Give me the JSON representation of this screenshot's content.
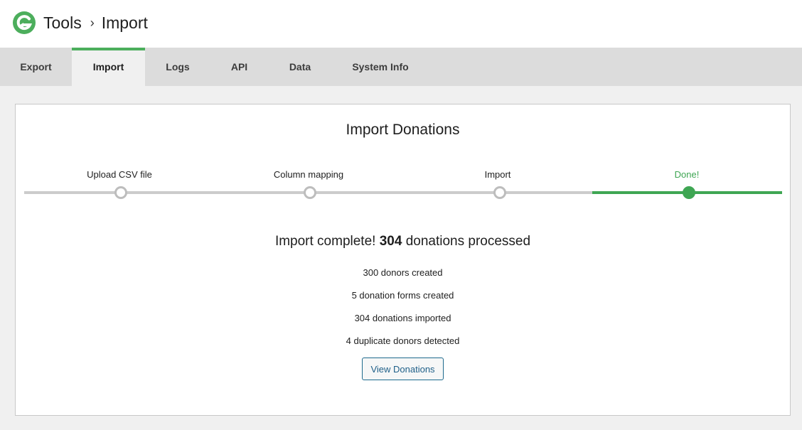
{
  "header": {
    "breadcrumb": [
      "Tools",
      "Import"
    ],
    "separator": "›",
    "brand_color": "#3fa653"
  },
  "tabs": [
    {
      "label": "Export",
      "active": false
    },
    {
      "label": "Import",
      "active": true
    },
    {
      "label": "Logs",
      "active": false
    },
    {
      "label": "API",
      "active": false
    },
    {
      "label": "Data",
      "active": false
    },
    {
      "label": "System Info",
      "active": false
    }
  ],
  "panel": {
    "title": "Import Donations",
    "steps": [
      {
        "label": "Upload CSV file",
        "state": "inactive"
      },
      {
        "label": "Column mapping",
        "state": "inactive"
      },
      {
        "label": "Import",
        "state": "inactive"
      },
      {
        "label": "Done!",
        "state": "complete"
      }
    ],
    "result": {
      "prefix": "Import complete!",
      "count": "304",
      "suffix": "donations processed"
    },
    "stats": [
      "300 donors created",
      "5 donation forms created",
      "304 donations imported",
      "4 duplicate donors detected"
    ],
    "view_button_label": "View Donations"
  },
  "colors": {
    "accent_green": "#3fa653",
    "track_gray": "#cccccc",
    "button_blue": "#1e5f88"
  },
  "icons": {
    "logo": "give-logo-icon"
  }
}
